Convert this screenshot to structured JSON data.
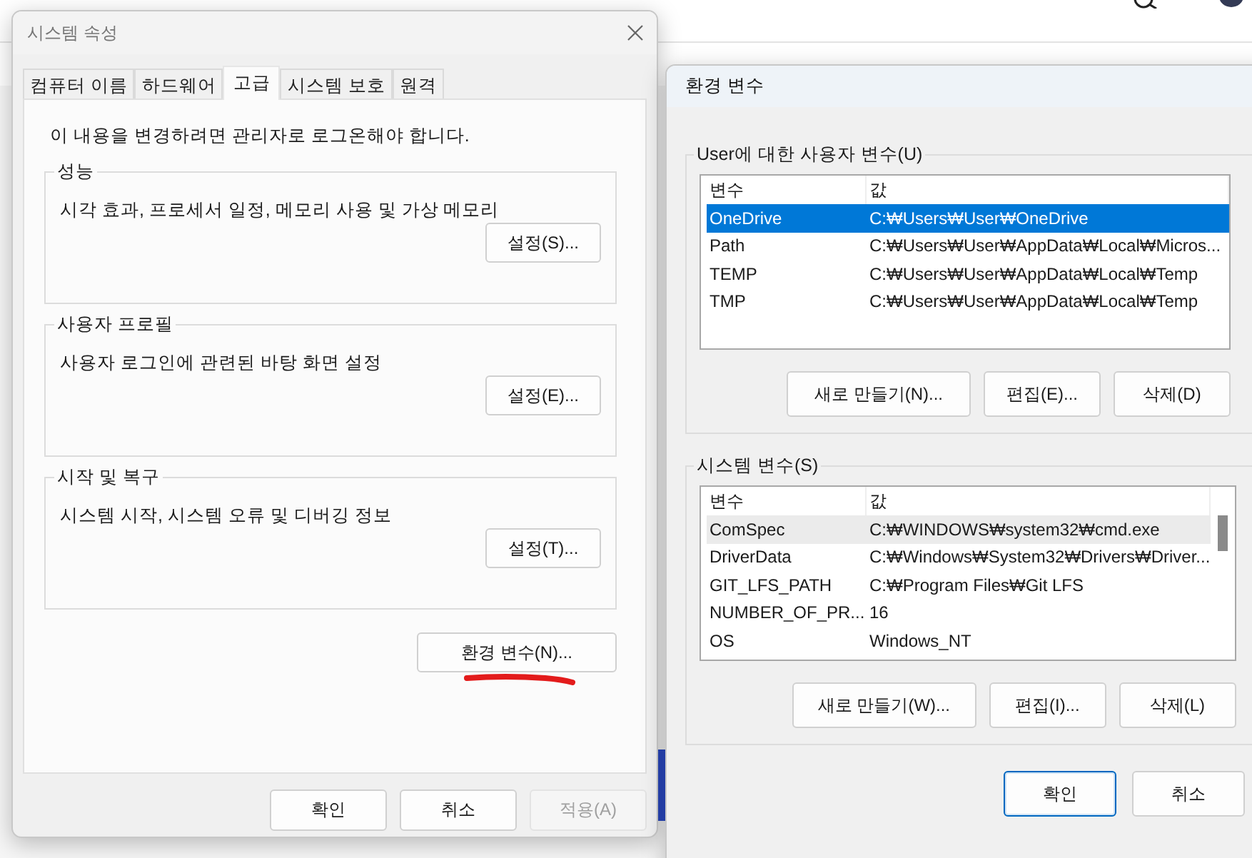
{
  "system_properties": {
    "title": "시스템 속성",
    "tabs": [
      {
        "label": "컴퓨터 이름",
        "selected": false
      },
      {
        "label": "하드웨어",
        "selected": false
      },
      {
        "label": "고급",
        "selected": true
      },
      {
        "label": "시스템 보호",
        "selected": false
      },
      {
        "label": "원격",
        "selected": false
      }
    ],
    "notice": "이 내용을 변경하려면 관리자로 로그온해야 합니다.",
    "groups": [
      {
        "title": "성능",
        "description": "시각 효과, 프로세서 일정, 메모리 사용 및 가상 메모리",
        "button": "설정(S)..."
      },
      {
        "title": "사용자 프로필",
        "description": "사용자 로그인에 관련된 바탕 화면 설정",
        "button": "설정(E)..."
      },
      {
        "title": "시작 및 복구",
        "description": "시스템 시작, 시스템 오류 및 디버깅 정보",
        "button": "설정(T)..."
      }
    ],
    "env_button": {
      "label": "환경 변수(N)...",
      "underlined": true
    },
    "buttons": [
      {
        "label": "확인",
        "default": false,
        "disabled": false
      },
      {
        "label": "취소",
        "default": false,
        "disabled": false
      },
      {
        "label": "적용(A)",
        "default": false,
        "disabled": true
      }
    ]
  },
  "environment_variables": {
    "title": "환경 변수",
    "sections": [
      {
        "title": "User에 대한 사용자 변수(U)",
        "focused": true,
        "scrollbar": false,
        "columns": [
          "변수",
          "값"
        ],
        "rows": [
          {
            "name": "OneDrive",
            "value": "C:₩Users₩User₩OneDrive",
            "selected": true
          },
          {
            "name": "Path",
            "value": "C:₩Users₩User₩AppData₩Local₩Micros...",
            "selected": false
          },
          {
            "name": "TEMP",
            "value": "C:₩Users₩User₩AppData₩Local₩Temp",
            "selected": false
          },
          {
            "name": "TMP",
            "value": "C:₩Users₩User₩AppData₩Local₩Temp",
            "selected": false
          }
        ],
        "buttons": [
          "새로 만들기(N)...",
          "편집(E)...",
          "삭제(D)"
        ]
      },
      {
        "title": "시스템 변수(S)",
        "focused": false,
        "scrollbar": true,
        "columns": [
          "변수",
          "값"
        ],
        "rows": [
          {
            "name": "ComSpec",
            "value": "C:₩WINDOWS₩system32₩cmd.exe",
            "selected": true
          },
          {
            "name": "DriverData",
            "value": "C:₩Windows₩System32₩Drivers₩Driver...",
            "selected": false
          },
          {
            "name": "GIT_LFS_PATH",
            "value": "C:₩Program Files₩Git LFS",
            "selected": false
          },
          {
            "name": "NUMBER_OF_PR...",
            "value": "16",
            "selected": false
          },
          {
            "name": "OS",
            "value": "Windows_NT",
            "selected": false
          }
        ],
        "buttons": [
          "새로 만들기(W)...",
          "편집(I)...",
          "삭제(L)"
        ]
      }
    ],
    "buttons": [
      {
        "label": "확인",
        "default": true,
        "disabled": false
      },
      {
        "label": "취소",
        "default": false,
        "disabled": false
      }
    ]
  }
}
